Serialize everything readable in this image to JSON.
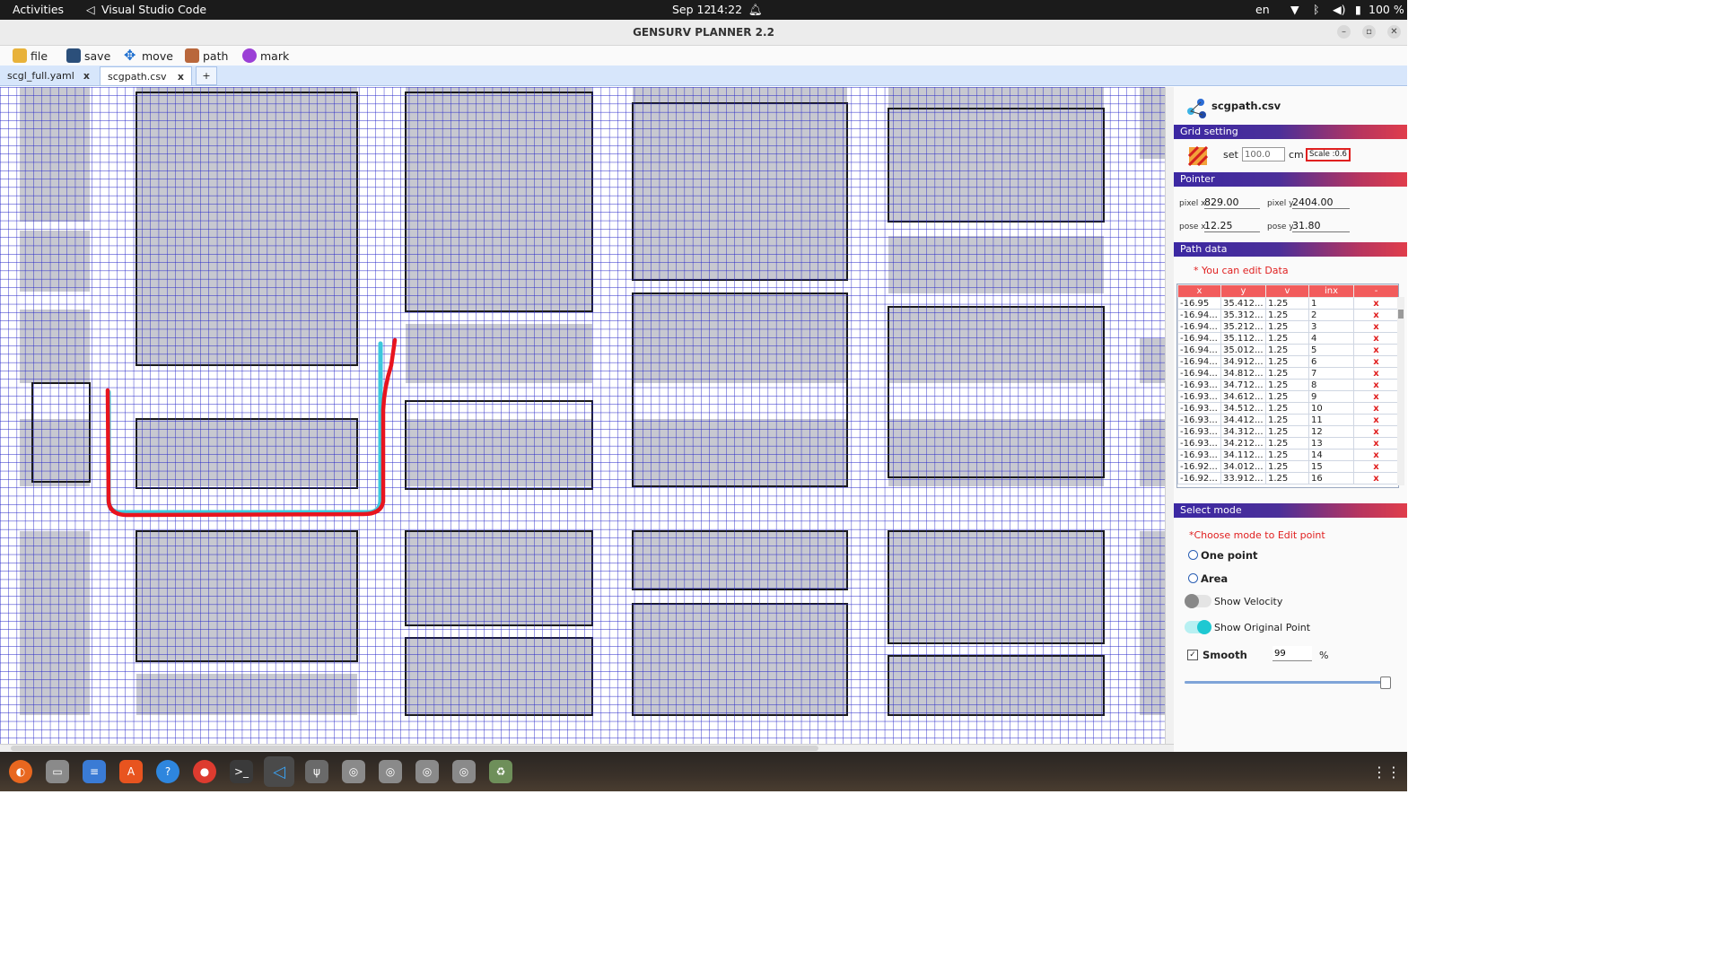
{
  "system_bar": {
    "activities": "Activities",
    "app_name": "Visual Studio Code",
    "date": "Sep 12",
    "time": "14:22",
    "lang": "en",
    "battery": "100 %"
  },
  "window": {
    "title": "GENSURV PLANNER 2.2"
  },
  "toolbar": {
    "file": "file",
    "save": "save",
    "move": "move",
    "path": "path",
    "mark": "mark"
  },
  "tabs": [
    {
      "label": "scgl_full.yaml",
      "close": "x"
    },
    {
      "label": "scgpath.csv",
      "close": "x"
    },
    {
      "label": "+"
    }
  ],
  "panel": {
    "file_name": "scgpath.csv",
    "grid_setting": {
      "header": "Grid setting",
      "set_label": "set",
      "value": "100.0",
      "unit": "cm",
      "scale": "Scale :0.6"
    },
    "pointer": {
      "header": "Pointer",
      "pixel_x_label": "pixel x",
      "pixel_x": "829.00",
      "pixel_y_label": "pixel y",
      "pixel_y": "2404.00",
      "pose_x_label": "pose x",
      "pose_x": "12.25",
      "pose_y_label": "pose y",
      "pose_y": "31.80"
    },
    "path_data": {
      "header": "Path data",
      "note": "* You can edit Data",
      "columns": [
        "x",
        "y",
        "v",
        "inx",
        "-"
      ],
      "rows": [
        [
          "-16.95",
          "35.412...",
          "1.25",
          "1",
          "x"
        ],
        [
          "-16.94...",
          "35.312...",
          "1.25",
          "2",
          "x"
        ],
        [
          "-16.94...",
          "35.212...",
          "1.25",
          "3",
          "x"
        ],
        [
          "-16.94...",
          "35.112...",
          "1.25",
          "4",
          "x"
        ],
        [
          "-16.94...",
          "35.012...",
          "1.25",
          "5",
          "x"
        ],
        [
          "-16.94...",
          "34.912...",
          "1.25",
          "6",
          "x"
        ],
        [
          "-16.94...",
          "34.812...",
          "1.25",
          "7",
          "x"
        ],
        [
          "-16.93...",
          "34.712...",
          "1.25",
          "8",
          "x"
        ],
        [
          "-16.93...",
          "34.612...",
          "1.25",
          "9",
          "x"
        ],
        [
          "-16.93...",
          "34.512...",
          "1.25",
          "10",
          "x"
        ],
        [
          "-16.93...",
          "34.412...",
          "1.25",
          "11",
          "x"
        ],
        [
          "-16.93...",
          "34.312...",
          "1.25",
          "12",
          "x"
        ],
        [
          "-16.93...",
          "34.212...",
          "1.25",
          "13",
          "x"
        ],
        [
          "-16.93...",
          "34.112...",
          "1.25",
          "14",
          "x"
        ],
        [
          "-16.92...",
          "34.012...",
          "1.25",
          "15",
          "x"
        ],
        [
          "-16.92...",
          "33.912...",
          "1.25",
          "16",
          "x"
        ]
      ]
    },
    "select_mode": {
      "header": "Select mode",
      "note": "*Choose mode to Edit point",
      "one_point": "One point",
      "area": "Area",
      "show_velocity": "Show Velocity",
      "show_velocity_on": false,
      "show_original_point": "Show Original Point",
      "show_original_point_on": true,
      "smooth": "Smooth",
      "smooth_checked": true,
      "smooth_value": "99",
      "smooth_unit": "%",
      "slider_level": 0.99
    }
  },
  "colors": {
    "grid": "#2323c8",
    "path_red": "#e8141e",
    "path_cyan": "#3cc8dc",
    "occupied": "#a7a9b4",
    "header_start": "#3b28a3",
    "header_end": "#e03d4b",
    "table_header": "#f25c5c"
  },
  "dock_icons": [
    "firefox-icon",
    "files-icon",
    "text-editor-icon",
    "app-store-icon",
    "help-icon",
    "chrome-icon",
    "terminal-icon",
    "vscode-icon",
    "usb-drive-icon",
    "disk-icon",
    "disk-icon",
    "disk-icon",
    "disk-icon",
    "trash-icon",
    "app-grid-icon"
  ]
}
